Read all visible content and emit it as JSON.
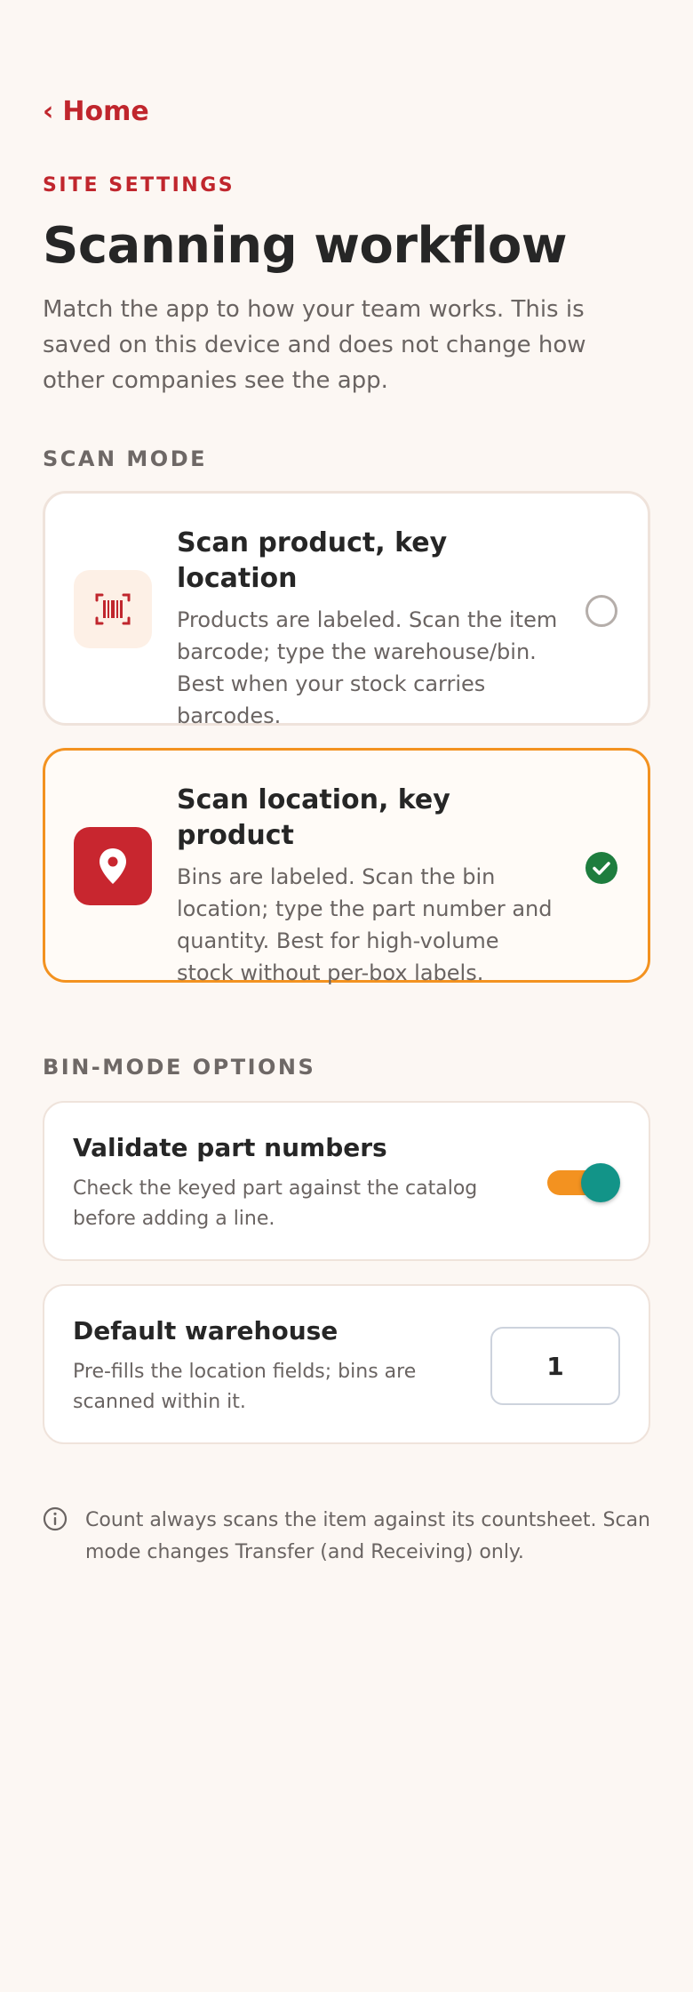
{
  "nav": {
    "chevron": "‹",
    "back_label": "Home"
  },
  "header": {
    "eyebrow": "SITE SETTINGS",
    "title": "Scanning workflow",
    "intro": "Match the app to how your team works. This is saved on this device and does not change how other companies see the app."
  },
  "scan_mode": {
    "label": "SCAN MODE",
    "options": [
      {
        "title": "Scan product, key location",
        "description": "Products are labeled. Scan the item barcode; type the warehouse/bin. Best when your stock carries barcodes.",
        "icon": "barcode-icon",
        "selected": false
      },
      {
        "title": "Scan location, key product",
        "description": "Bins are labeled. Scan the bin location; type the part number and quantity. Best for high-volume stock without per-box labels.",
        "icon": "location-pin-icon",
        "selected": true
      }
    ]
  },
  "bin_options": {
    "label": "BIN-MODE OPTIONS",
    "validate": {
      "title": "Validate part numbers",
      "description": "Check the keyed part against the catalog before adding a line.",
      "enabled": true
    },
    "warehouse": {
      "title": "Default warehouse",
      "description": "Pre-fills the location fields; bins are scanned within it.",
      "value": "1"
    }
  },
  "note": {
    "icon": "info-icon",
    "text": "Count always scans the item against its countsheet. Scan mode changes Transfer (and Receiving) only."
  },
  "colors": {
    "accent_red": "#c0262d",
    "selected_border": "#f39220",
    "toggle_knob": "#129488",
    "check_green": "#1e7d3e"
  }
}
